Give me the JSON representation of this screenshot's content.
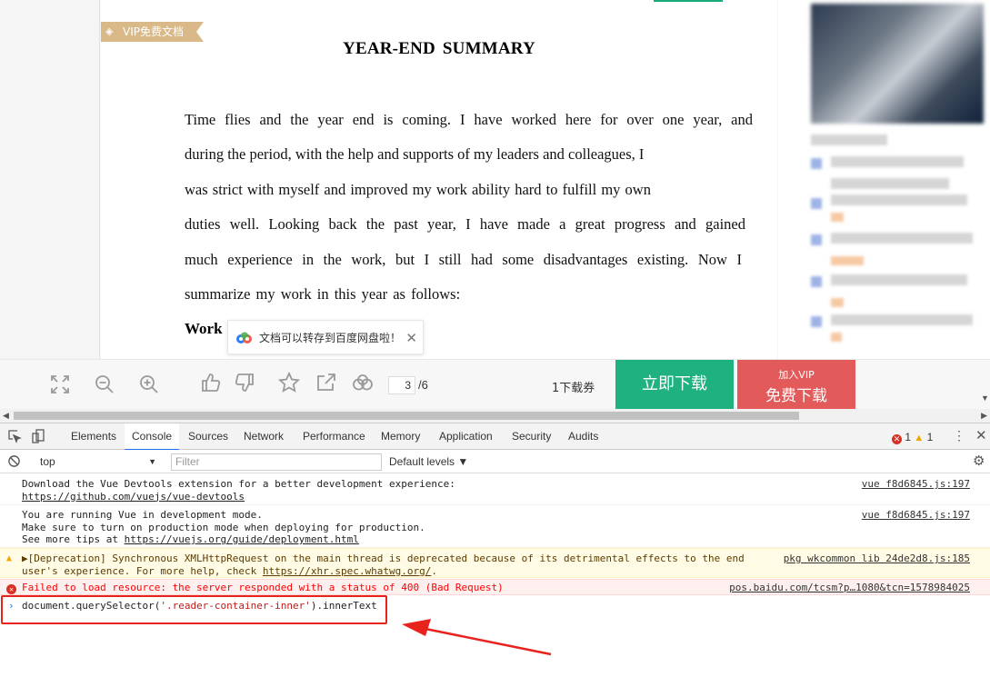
{
  "document": {
    "vip_tag": "VIP免费文档",
    "title": "YEAR-END  SUMMARY",
    "lines": [
      "Time flies and the year end is coming. I have worked here for over one year, and",
      "during the period, with the help and supports of my leaders and colleagues, I",
      "was strict with myself and improved my work ability hard to fulfill my own",
      "duties well. Looking back the past year, I have made a great progress and gained",
      "much experience in the work, but I still had some disadvantages existing. Now I",
      "summarize my work in this year as follows:"
    ],
    "section_heading": "Work",
    "toast_text": "文档可以转存到百度网盘啦！",
    "toast_close": "✕"
  },
  "toolbar": {
    "current_page": "3",
    "total_pages": "/6",
    "voucher": "1下载券",
    "download_label": "立即下载",
    "vip_small": "加入VIP",
    "vip_big": "免费下载",
    "icons": [
      "fullscreen-icon",
      "zoom-out-icon",
      "zoom-in-icon",
      "thumbs-up-icon",
      "thumbs-down-icon",
      "star-icon",
      "share-icon",
      "baidu-cloud-icon"
    ]
  },
  "devtools": {
    "tabs": [
      "Elements",
      "Console",
      "Sources",
      "Network",
      "Performance",
      "Memory",
      "Application",
      "Security",
      "Audits"
    ],
    "active_tab": "Console",
    "error_count": "1",
    "warning_count": "1",
    "context": "top",
    "filter_placeholder": "Filter",
    "levels": "Default levels ▼",
    "messages": [
      {
        "type": "log",
        "lines": [
          "Download the Vue Devtools extension for a better development experience:"
        ],
        "link": "https://github.com/vuejs/vue-devtools",
        "source": "vue f8d6845.js:197"
      },
      {
        "type": "log",
        "lines": [
          "You are running Vue in development mode.",
          "Make sure to turn on production mode when deploying for production."
        ],
        "prefix": "See more tips at ",
        "link": "https://vuejs.org/guide/deployment.html",
        "source": "vue f8d6845.js:197"
      },
      {
        "type": "warning",
        "line1": "▶[Deprecation] Synchronous XMLHttpRequest on the main thread is deprecated because of its detrimental effects to the end",
        "line2_prefix": "user's experience. For more help, check ",
        "link": "https://xhr.spec.whatwg.org/",
        "line2_suffix": ".",
        "source": "pkg wkcommon lib 24de2d8.js:185"
      },
      {
        "type": "error",
        "text": "Failed to load resource: the server responded with a status of 400 (Bad Request)",
        "source": "pos.baidu.com/tcsm?p…1080&tcn=1578984025"
      }
    ],
    "prompt": {
      "prefix": "document.querySelector(",
      "string": "'.reader-container-inner'",
      "suffix": ").innerText"
    }
  },
  "colors": {
    "download_green": "#1fb180",
    "vip_red": "#e25a5a",
    "vip_tag_gold": "#d9b988",
    "highlight_red": "#e8221c"
  }
}
